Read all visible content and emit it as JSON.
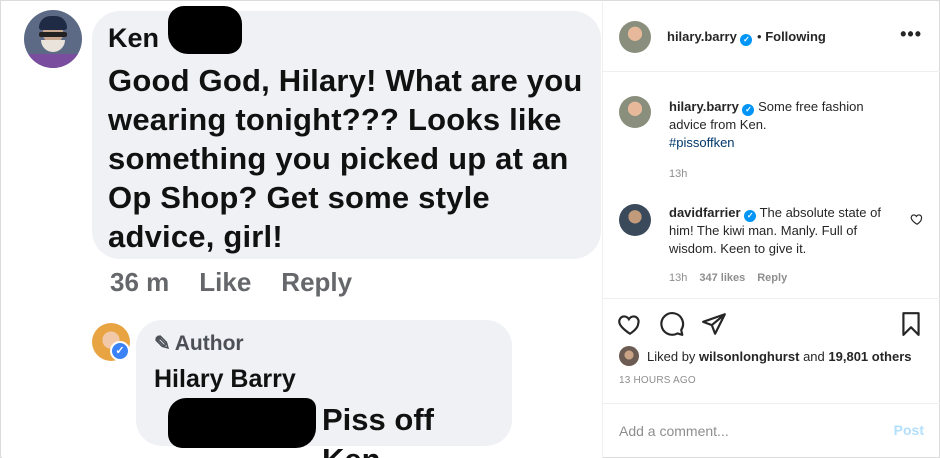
{
  "post_image": {
    "fb_comment": {
      "author": "Ken",
      "text": "Good God, Hilary! What are you wearing tonight??? Looks like something you picked up at an Op Shop? Get some style advice, girl!",
      "time": "36 m",
      "like": "Like",
      "reply": "Reply"
    },
    "fb_reply": {
      "badge": "Author",
      "author": "Hilary Barry",
      "text": "Piss off Ken."
    }
  },
  "header": {
    "username": "hilary.barry",
    "separator": "•",
    "follow_label": "Following",
    "more": "•••"
  },
  "caption": {
    "username": "hilary.barry",
    "text": "Some free fashion advice from Ken.",
    "hashtag": "#pissoffken",
    "time": "13h"
  },
  "comments": [
    {
      "username": "davidfarrier",
      "text": "The absolute state of him! The kiwi man. Manly. Full of wisdom. Keen to give it.",
      "time": "13h",
      "likes": "347 likes",
      "reply": "Reply"
    }
  ],
  "likes": {
    "prefix": "Liked by",
    "user": "wilsonlonghurst",
    "middle": "and",
    "count": "19,801 others"
  },
  "timestamp": "13 HOURS AGO",
  "add_comment": {
    "placeholder": "Add a comment...",
    "post_label": "Post"
  },
  "colors": {
    "verified": "#0095f6",
    "link": "#00376b",
    "muted": "#8e8e8e",
    "post_disabled": "#b2dffc"
  }
}
